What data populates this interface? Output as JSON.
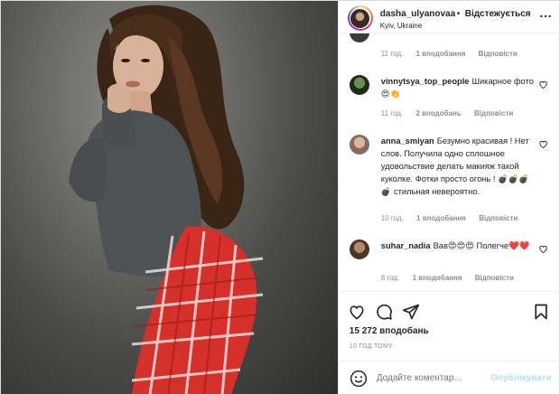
{
  "header": {
    "username": "dasha_ulyanovaa",
    "separator": "•",
    "follow_label": "Відстежується",
    "location": "Kyiv, Ukraine",
    "more_icon": "more-horizontal-icon"
  },
  "comments": [
    {
      "username": "",
      "text": "",
      "age": "11 год.",
      "likes": "1 вподобання",
      "reply": "Відповісти"
    },
    {
      "username": "vinnytsya_top_people",
      "text": "Шикарное фото 😍👏",
      "age": "11 год.",
      "likes": "2 вподобань",
      "reply": "Відповісти"
    },
    {
      "username": "anna_smiyan",
      "text": "Безумно красивая ! Нет слов. Получила одно сплошное удовольствие делать макияж такой куколке. Фотки просто огонь ! 💣💣💣💣 стильная невероятно.",
      "age": "10 год.",
      "likes": "1 вподобання",
      "reply": "Відповісти"
    },
    {
      "username": "suhar_nadia",
      "text": "Вав😍😍😍 Полегче❤️❤️",
      "age": "8 год.",
      "likes": "1 вподобання",
      "reply": "Відповісти"
    }
  ],
  "actions": {
    "like_icon": "heart-icon",
    "comment_icon": "comment-icon",
    "share_icon": "share-icon",
    "save_icon": "bookmark-icon",
    "likes_count": "15 272 вподобань",
    "timestamp": "10 ГОД ТОМУ"
  },
  "add_comment": {
    "placeholder": "Додайте коментар...",
    "publish_label": "Опублікувати",
    "emoji_icon": "emoji-icon"
  },
  "colors": {
    "text": "#262626",
    "muted": "#8e8e8e",
    "publish_disabled": "#b2dffc",
    "border": "#efefef"
  }
}
